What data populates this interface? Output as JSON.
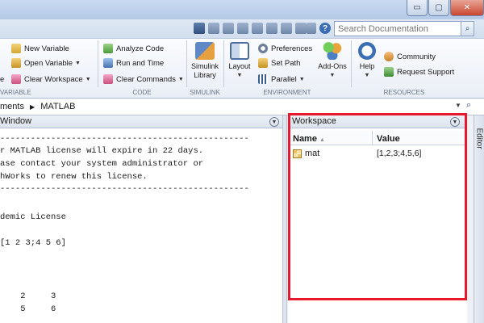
{
  "window": {
    "minimize_label": "▭",
    "maximize_label": "▢",
    "close_label": "✕"
  },
  "search": {
    "placeholder": "Search Documentation",
    "button_icon": "magnifier-icon"
  },
  "ribbon": {
    "variable_group": {
      "label": "VARIABLE",
      "items": [
        "New Variable",
        "Open Variable",
        "Clear Workspace"
      ]
    },
    "code_group": {
      "label": "CODE",
      "items": [
        "Analyze Code",
        "Run and Time",
        "Clear Commands"
      ]
    },
    "simulink_group": {
      "label": "SIMULINK",
      "button_line1": "Simulink",
      "button_line2": "Library"
    },
    "environment_group": {
      "label": "ENVIRONMENT",
      "layout_label": "Layout",
      "preferences": "Preferences",
      "set_path": "Set Path",
      "parallel": "Parallel",
      "addons_label": "Add-Ons"
    },
    "resources_group": {
      "label": "RESOURCES",
      "help_label": "Help",
      "community": "Community",
      "request_support": "Request Support"
    }
  },
  "path": {
    "partial_segment": "ments",
    "separator": "▶",
    "current_folder": "MATLAB"
  },
  "command_window": {
    "title": "Window",
    "lines": [
      "-------------------------------------------------",
      "r MATLAB license will expire in 22 days.",
      "ase contact your system administrator or",
      "hWorks to renew this license.",
      "-------------------------------------------------",
      "",
      "demic License",
      "",
      "[1 2 3;4 5 6]",
      "",
      "",
      "",
      "    2     3",
      "    5     6"
    ]
  },
  "workspace": {
    "title": "Workspace",
    "columns": {
      "name": "Name",
      "name_sort": "▲",
      "value": "Value"
    },
    "variables": [
      {
        "name": "mat",
        "value": "[1,2,3;4,5,6]"
      }
    ]
  },
  "editor_tab": {
    "label": "Editor"
  },
  "colors": {
    "highlight": "#e8192c",
    "ribbon_bg": "#f3f6fa",
    "header_bg": "#e2e8f1"
  }
}
